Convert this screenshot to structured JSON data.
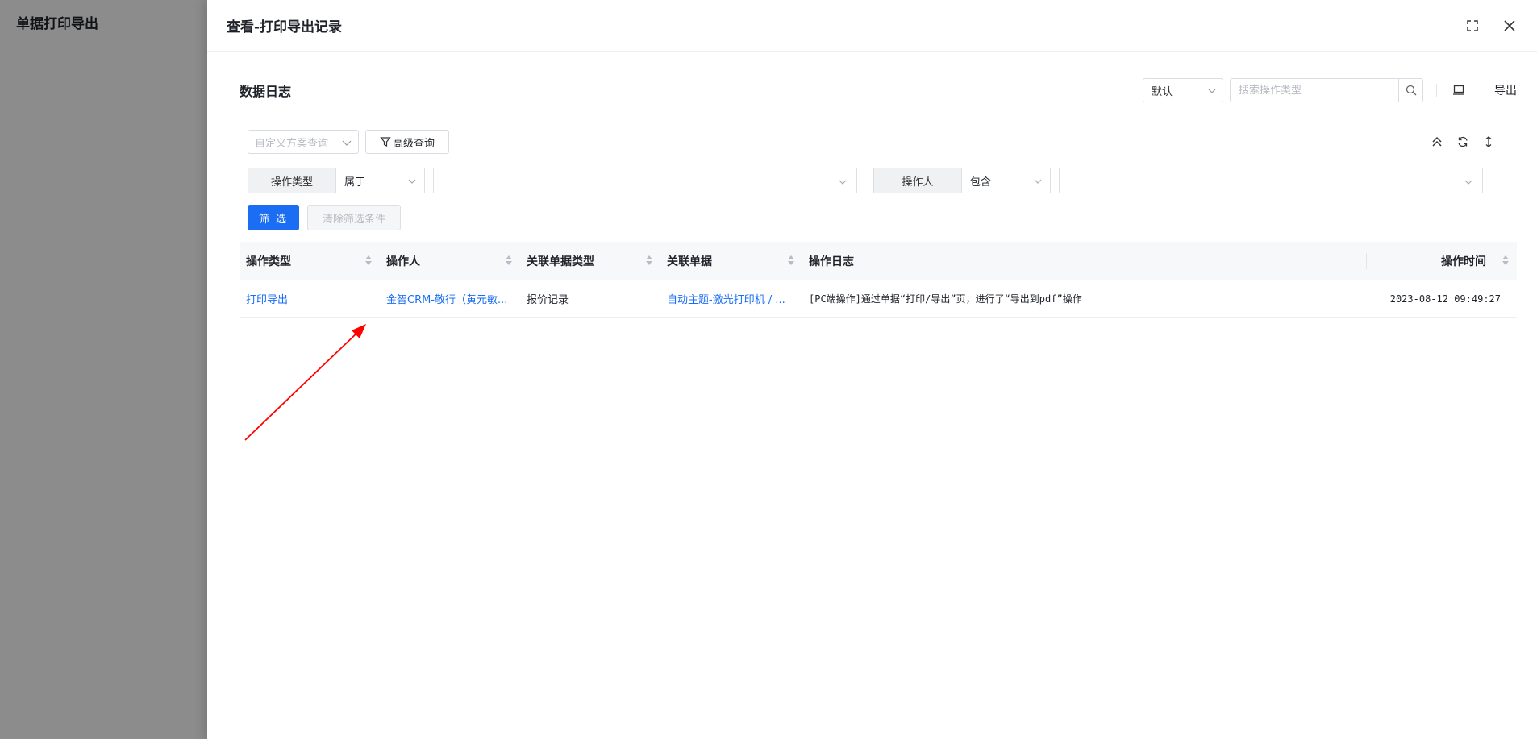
{
  "background": {
    "title": "单据打印导出"
  },
  "drawer": {
    "title": "查看-打印导出记录",
    "section_title": "数据日志",
    "default_select": "默认",
    "search_placeholder": "搜索操作类型",
    "export_label": "导出"
  },
  "filters": {
    "scheme_placeholder": "自定义方案查询",
    "advanced_label": "高级查询",
    "conditions": [
      {
        "label": "操作类型",
        "operator": "属于",
        "value": ""
      },
      {
        "label": "操作人",
        "operator": "包含",
        "value": ""
      }
    ],
    "filter_button": "筛 选",
    "clear_button": "清除筛选条件"
  },
  "table": {
    "columns": [
      "操作类型",
      "操作人",
      "关联单据类型",
      "关联单据",
      "操作日志",
      "操作时间"
    ],
    "rows": [
      {
        "op_type": "打印导出",
        "operator": "金智CRM-敬行（黄元敏...",
        "doc_type": "报价记录",
        "doc": "自动主题-激光打印机 / ...",
        "log": "[PC端操作]通过单据“打印/导出”页，进行了“导出到pdf”操作",
        "time": "2023-08-12 09:49:27"
      }
    ]
  },
  "colors": {
    "accent": "#1b6ef3",
    "annotation_arrow": "#ff0000"
  }
}
